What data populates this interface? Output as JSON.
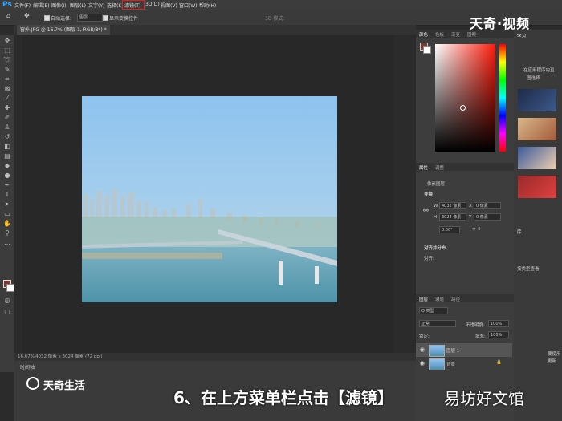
{
  "menubar": {
    "logo": "Ps",
    "items": [
      "文件(F)",
      "编辑(E)",
      "图像(I)",
      "图层(L)",
      "文字(Y)",
      "选择(S)",
      "滤镜(T)",
      "3D(D)",
      "视图(V)",
      "窗口(W)",
      "帮助(H)"
    ],
    "highlighted": "滤镜(T)"
  },
  "options": {
    "auto_select_label": "自动选择:",
    "auto_select_value": "图层",
    "show_transform_label": "显示变换控件",
    "mode_3d": "3D 模式:"
  },
  "doc_tab": {
    "title": "窗外.JPG @ 16.7% (图层 1, RGB/8*) *"
  },
  "status": {
    "zoom": "16.67%",
    "size": "4032 像素 x 3024 像素 (72 ppi)"
  },
  "timeline": {
    "title": "时间轴"
  },
  "panels": {
    "color_tabs": [
      "颜色",
      "色板",
      "渐变",
      "图案"
    ],
    "learn_tab": "学习",
    "learn_text_1": "在应用程序内直",
    "learn_text_2": "图选择",
    "properties_tabs": [
      "属性",
      "调整"
    ],
    "pixel_layer": "像素图层",
    "transform_label": "变换",
    "w_label": "W",
    "w_value": "4032 像素",
    "x_label": "X",
    "x_value": "0 像素",
    "h_label": "H",
    "h_value": "3024 像素",
    "y_label": "Y",
    "y_value": "0 像素",
    "angle_value": "0.00°",
    "align_label": "对齐并分布",
    "align_sub": "对齐:",
    "layers_tabs": [
      "图层",
      "通道",
      "路径"
    ],
    "kind_label": "Q 类型",
    "blend_mode": "正常",
    "opacity_label": "不透明度:",
    "opacity_value": "100%",
    "lock_label": "锁定:",
    "fill_label": "填充:",
    "fill_value": "100%",
    "layers": [
      "图层 1",
      "背景"
    ],
    "right_tab": "库",
    "right_text": "按类型查看",
    "right_text_2": "要使用",
    "right_text_3": "更新"
  },
  "caption": "6、在上方菜单栏点击【滤镜】",
  "watermark_top": "天奇·视频",
  "watermark_left": "天奇生活",
  "watermark_right": "易坊好文馆",
  "colors": {
    "accent": "#31a8ff",
    "highlight_box": "#e02020",
    "foreground_swatch": "#7a3a32"
  }
}
